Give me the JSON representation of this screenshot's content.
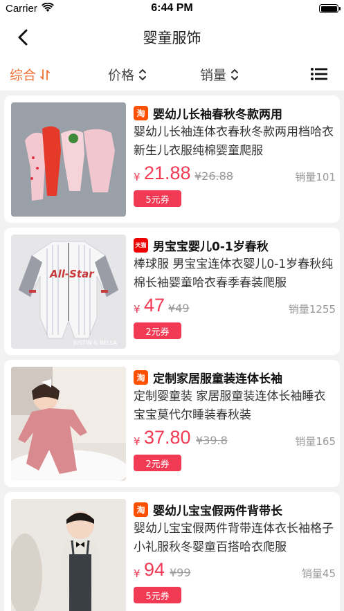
{
  "status_bar": {
    "carrier": "Carrier",
    "time": "6:44 PM"
  },
  "nav": {
    "title": "婴童服饰"
  },
  "filters": {
    "comprehensive": "综合",
    "price": "价格",
    "sales": "销量"
  },
  "colors": {
    "accent": "#f07238",
    "price": "#f23a55",
    "taobao": "#ff5000",
    "tmall": "#ee0000"
  },
  "products": [
    {
      "platform": "taobao",
      "platform_label": "淘",
      "title": "婴幼儿长袖春秋冬款两用",
      "desc": "婴幼儿长袖连体衣春秋冬款两用档哈衣新生儿衣服纯棉婴童爬服",
      "currency": "¥",
      "price": "21.88",
      "original_price": "¥26.88",
      "sales": "销量101",
      "coupon": "5元券"
    },
    {
      "platform": "tmall",
      "platform_label": "天猫",
      "title": "男宝宝婴儿0-1岁春秋",
      "desc": "棒球服 男宝宝连体衣婴儿0-1岁春秋纯棉长袖婴童哈衣春季春装爬服",
      "currency": "¥",
      "price": "47",
      "original_price": "¥49",
      "sales": "销量1255",
      "coupon": "2元券",
      "image_text": "JUSTIN & BELLA"
    },
    {
      "platform": "taobao",
      "platform_label": "淘",
      "title": "定制家居服童装连体长袖",
      "desc": "定制婴童装 家居服童装连体长袖睡衣宝宝莫代尔睡装春秋装",
      "currency": "¥",
      "price": "37.80",
      "original_price": "¥39.8",
      "sales": "销量165",
      "coupon": "2元券"
    },
    {
      "platform": "taobao",
      "platform_label": "淘",
      "title": "婴幼儿宝宝假两件背带长",
      "desc": "婴幼儿宝宝假两件背带连体衣长袖格子小礼服秋冬婴童百搭哈衣爬服",
      "currency": "¥",
      "price": "94",
      "original_price": "¥99",
      "sales": "销量45",
      "coupon": "5元券"
    }
  ]
}
